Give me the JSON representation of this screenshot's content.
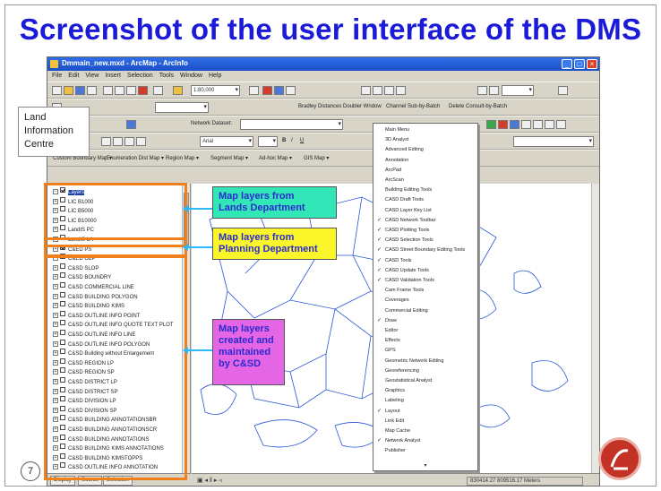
{
  "slide": {
    "title": "Screenshot of the user interface of the DMS",
    "page_number": "7"
  },
  "window": {
    "title": "Dmmain_new.mxd - ArcMap - ArcInfo",
    "menu": [
      "File",
      "Edit",
      "View",
      "Insert",
      "Selection",
      "Tools",
      "Window",
      "Help"
    ],
    "scale": "1:80,000",
    "toolbar_labels": [
      "Bradley Distances",
      "Doubler Wndow",
      "Channel Sub-by-Batch",
      "Delete Consult-by-Batch"
    ],
    "font_combo": "Arial",
    "network_dataset": "Network Dataset:",
    "coords": "830414.27  809516.17 Meters"
  },
  "toc": {
    "layers": [
      {
        "name": "Layers",
        "checked": true,
        "selected": true
      },
      {
        "name": "LIC B1000",
        "checked": false
      },
      {
        "name": "LIC B5000",
        "checked": false
      },
      {
        "name": "LIC B10000",
        "checked": false
      },
      {
        "name": "LandIS PC",
        "checked": false
      },
      {
        "name": "LandIS LA",
        "checked": false
      },
      {
        "name": "C&ED PS",
        "checked": true
      },
      {
        "name": "C&ED OZP",
        "checked": false
      },
      {
        "name": "C&SD SLOP",
        "checked": false
      },
      {
        "name": "C&SD BOUNDRY",
        "checked": false
      },
      {
        "name": "C&SD COMMERCIAL LINE",
        "checked": false
      },
      {
        "name": "C&SD BUILDING POLYGON",
        "checked": false
      },
      {
        "name": "C&SD BUILDING KIMS",
        "checked": false
      },
      {
        "name": "C&SD OUTLINE INFO POINT",
        "checked": false
      },
      {
        "name": "C&SD OUTLINE INFO QUOTE TEXT PLOT",
        "checked": false
      },
      {
        "name": "C&SD OUTLINE INFO LINE",
        "checked": false
      },
      {
        "name": "C&SD OUTLINE INFO POLYGON",
        "checked": false
      },
      {
        "name": "C&SD Building without Enlargement",
        "checked": false
      },
      {
        "name": "C&SD REGION LP",
        "checked": false
      },
      {
        "name": "C&SD REGION SP",
        "checked": false
      },
      {
        "name": "C&SD DISTRICT LP",
        "checked": false
      },
      {
        "name": "C&SD DISTRICT SP",
        "checked": false
      },
      {
        "name": "C&SD DIVISION LP",
        "checked": false
      },
      {
        "name": "C&SD DIVISION SP",
        "checked": false
      },
      {
        "name": "C&SD BUILDING ANNOTATIONSBR",
        "checked": false
      },
      {
        "name": "C&SD BUILDING ANNOTATIONSCR",
        "checked": false
      },
      {
        "name": "C&SD BUILDING ANNOTATIONS",
        "checked": false
      },
      {
        "name": "C&SD BUILDING KIMS ANNOTATIONS",
        "checked": false
      },
      {
        "name": "C&SD BUILDING KIMSTOPPS",
        "checked": false
      },
      {
        "name": "C&SD OUTLINE INFO ANNOTATION",
        "checked": false
      }
    ],
    "tabs": [
      "Display",
      "Source",
      "Selection"
    ]
  },
  "dropdown": {
    "items": [
      {
        "label": "Main Menu",
        "checked": false
      },
      {
        "label": "3D Analyst",
        "checked": false
      },
      {
        "label": "Advanced Editing",
        "checked": false
      },
      {
        "label": "Annotation",
        "checked": false
      },
      {
        "label": "ArcPad",
        "checked": false
      },
      {
        "label": "ArcScan",
        "checked": false
      },
      {
        "label": "Building Editing Tools",
        "checked": false
      },
      {
        "label": "CASD Draft Tools",
        "checked": false
      },
      {
        "label": "CASD Layer Key List",
        "checked": false
      },
      {
        "label": "CASD Network Toolbar",
        "checked": true
      },
      {
        "label": "CASD Plotting Tools",
        "checked": true
      },
      {
        "label": "CASD Selection Tools",
        "checked": true
      },
      {
        "label": "CASD Street Boundary Editing Tools",
        "checked": true
      },
      {
        "label": "CASD Tools",
        "checked": true
      },
      {
        "label": "CASD Update Tools",
        "checked": true
      },
      {
        "label": "CASD Validation Tools",
        "checked": true
      },
      {
        "label": "Cam Frame Tools",
        "checked": false
      },
      {
        "label": "Coverages",
        "checked": false
      },
      {
        "label": "Commercial Editing",
        "checked": false
      },
      {
        "label": "Draw",
        "checked": true
      },
      {
        "label": "Editor",
        "checked": false
      },
      {
        "label": "Effects",
        "checked": false
      },
      {
        "label": "GPS",
        "checked": false
      },
      {
        "label": "Geometric Network Editing",
        "checked": false
      },
      {
        "label": "Georeferencing",
        "checked": false
      },
      {
        "label": "Geostatistical Analyst",
        "checked": false
      },
      {
        "label": "Graphics",
        "checked": false
      },
      {
        "label": "Labeling",
        "checked": false
      },
      {
        "label": "Layout",
        "checked": true
      },
      {
        "label": "Link Edit",
        "checked": false
      },
      {
        "label": "Map Cache",
        "checked": false
      },
      {
        "label": "Network Analyst",
        "checked": true
      },
      {
        "label": "Publisher",
        "checked": false
      }
    ]
  },
  "callouts": {
    "lic": [
      "Land",
      "Information",
      "Centre"
    ],
    "lands": [
      "Map layers from",
      "Lands Department"
    ],
    "planning": [
      "Map layers from",
      "Planning Department"
    ],
    "csd": [
      "Map layers",
      "created and",
      "maintained",
      "by C&SD"
    ]
  },
  "colors": {
    "title": "#1a1ad8",
    "callout_lands": "#33e6b8",
    "callout_planning": "#fbf62a",
    "callout_csd": "#e566e4",
    "group_box": "#f07f1d",
    "map_lines": "#2b56d8"
  }
}
